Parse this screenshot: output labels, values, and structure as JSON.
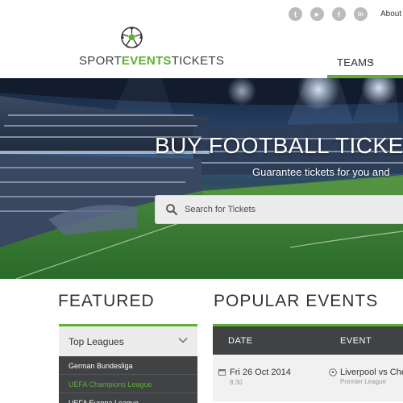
{
  "header": {
    "social": [
      {
        "icon": "twitter-icon",
        "glyph": "t"
      },
      {
        "icon": "youtube-icon",
        "glyph": "▶"
      },
      {
        "icon": "facebook-icon",
        "glyph": "f"
      },
      {
        "icon": "linkedin-icon",
        "glyph": "in"
      }
    ],
    "about_link": "About U",
    "logo": {
      "part1": "SPORT",
      "part2": "EVENTS",
      "part3": "TICKETS"
    },
    "nav": {
      "teams": "TEAMS"
    }
  },
  "hero": {
    "title": "BUY FOOTBALL TICKETS",
    "subtitle": "Guarantee tickets for you and",
    "search_placeholder": "Search for Tickets"
  },
  "featured": {
    "title": "FEATURED",
    "dropdown_label": "Top Leagues",
    "leagues": [
      {
        "label": "German Bundesliga",
        "active": false
      },
      {
        "label": "UEFA Champions League",
        "active": true
      },
      {
        "label": "UEFA Europa League",
        "active": false
      }
    ]
  },
  "popular": {
    "title": "POPULAR EVENTS",
    "columns": {
      "date": "DATE",
      "event": "EVENT"
    },
    "events": [
      {
        "date": "Fri 26 Oct 2014",
        "time": "8:30",
        "match": "Liverpool vs Che",
        "competition": "Premier League"
      }
    ]
  },
  "colors": {
    "accent": "#5cb130",
    "dark_panel": "#404244",
    "light_panel": "#ececec"
  }
}
